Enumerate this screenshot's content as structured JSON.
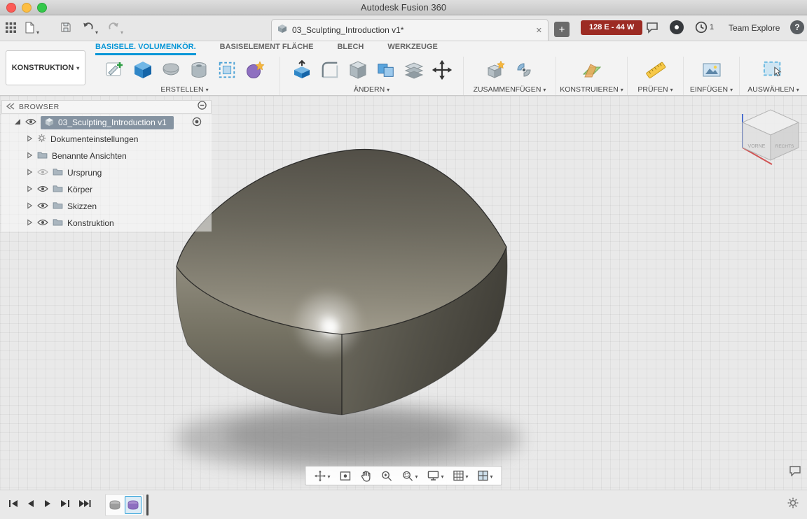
{
  "window": {
    "title": "Autodesk Fusion 360"
  },
  "topbar": {
    "tab_title": "03_Sculpting_Introduction v1*",
    "error_badge": "128 E - 44 W",
    "jobs_count": "1",
    "team_label": "Team Explore",
    "help_glyph": "?"
  },
  "ribbon": {
    "workspace_label": "KONSTRUKTION",
    "tabs": [
      {
        "label": "BASISELE. VOLUMENKÖR.",
        "active": true
      },
      {
        "label": "BASISELEMENT FLÄCHE",
        "active": false
      },
      {
        "label": "BLECH",
        "active": false
      },
      {
        "label": "WERKZEUGE",
        "active": false
      }
    ],
    "groups": [
      {
        "label": "ERSTELLEN"
      },
      {
        "label": "ÄNDERN"
      },
      {
        "label": "ZUSAMMENFÜGEN"
      },
      {
        "label": "KONSTRUIEREN"
      },
      {
        "label": "PRÜFEN"
      },
      {
        "label": "EINFÜGEN"
      },
      {
        "label": "AUSWÄHLEN"
      }
    ]
  },
  "browser": {
    "title": "BROWSER",
    "root_label": "03_Sculpting_Introduction v1",
    "items": [
      {
        "label": "Dokumenteinstellungen"
      },
      {
        "label": "Benannte Ansichten"
      },
      {
        "label": "Ursprung"
      },
      {
        "label": "Körper"
      },
      {
        "label": "Skizzen"
      },
      {
        "label": "Konstruktion"
      }
    ]
  },
  "viewcube": {
    "front_label": "VORNE",
    "right_label": "RECHTS"
  },
  "colors": {
    "accent": "#0696d7",
    "badge_red": "#9c2b23",
    "canvas": "#e9e9e9"
  }
}
